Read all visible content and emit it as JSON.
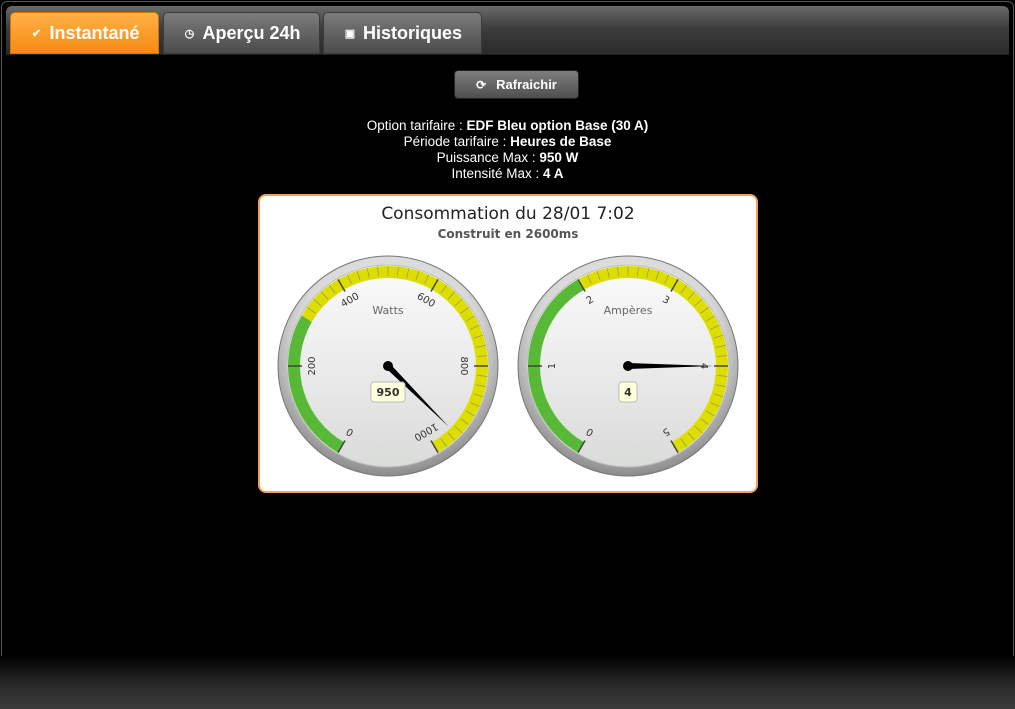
{
  "tabs": [
    {
      "label": "Instantané",
      "icon": "check-icon",
      "active": true
    },
    {
      "label": "Aperçu 24h",
      "icon": "clock-icon",
      "active": false
    },
    {
      "label": "Historiques",
      "icon": "calendar-icon",
      "active": false
    }
  ],
  "refresh": {
    "label": "Rafraichir",
    "icon": "refresh-icon"
  },
  "info": {
    "option_label": "Option tarifaire : ",
    "option_value": "EDF Bleu option Base (30 A)",
    "periode_label": "Période tarifaire : ",
    "periode_value": "Heures de Base",
    "puissance_label": "Puissance Max : ",
    "puissance_value": "950 W",
    "intensite_label": "Intensité Max : ",
    "intensite_value": "4 A"
  },
  "chart_data": {
    "type": "gauge",
    "title": "Consommation du 28/01 7:02",
    "subtitle": "Construit en 2600ms",
    "gauges": [
      {
        "name": "Watts",
        "min": 0,
        "max": 1000,
        "value": 950,
        "value_label": "950",
        "ticks": [
          "0",
          "200",
          "400",
          "600",
          "800",
          "1000"
        ],
        "bands": [
          {
            "from": 0,
            "to": 300,
            "color": "#55bb33"
          },
          {
            "from": 300,
            "to": 1000,
            "color": "#dddd00"
          }
        ]
      },
      {
        "name": "Ampères",
        "min": 0,
        "max": 5,
        "value": 4,
        "value_label": "4",
        "ticks": [
          "0",
          "1",
          "2",
          "3",
          "4",
          "5"
        ],
        "bands": [
          {
            "from": 0,
            "to": 2,
            "color": "#55bb33"
          },
          {
            "from": 2,
            "to": 5,
            "color": "#dddd00"
          }
        ]
      }
    ]
  },
  "colors": {
    "accent": "#f68a12",
    "panel_border": "#f0a060"
  }
}
